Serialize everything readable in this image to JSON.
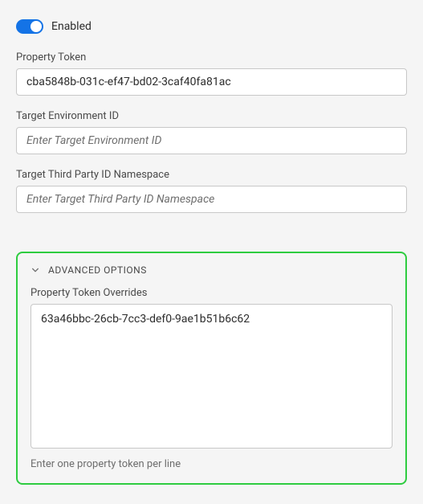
{
  "toggle": {
    "label": "Enabled",
    "checked": true
  },
  "fields": {
    "propertyToken": {
      "label": "Property Token",
      "value": "cba5848b-031c-ef47-bd02-3caf40fa81ac"
    },
    "targetEnvId": {
      "label": "Target Environment ID",
      "placeholder": "Enter Target Environment ID",
      "value": ""
    },
    "targetThirdParty": {
      "label": "Target Third Party ID Namespace",
      "placeholder": "Enter Target Third Party ID Namespace",
      "value": ""
    }
  },
  "advanced": {
    "title": "ADVANCED OPTIONS",
    "overrides": {
      "label": "Property Token Overrides",
      "value": "63a46bbc-26cb-7cc3-def0-9ae1b51b6c62",
      "helper": "Enter one property token per line"
    }
  },
  "colors": {
    "accent": "#1473e6",
    "highlightBorder": "#2ecc40"
  }
}
